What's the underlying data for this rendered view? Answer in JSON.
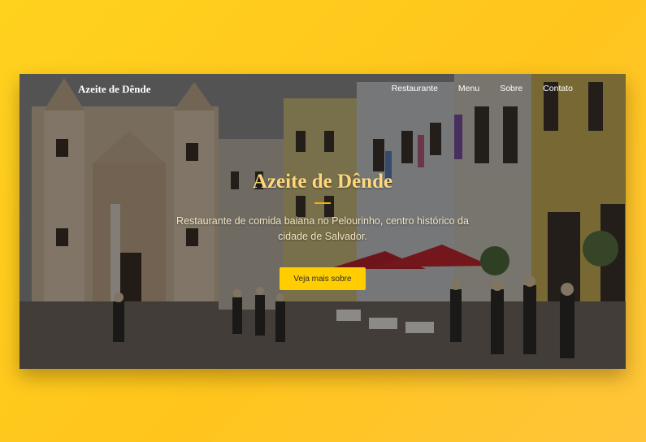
{
  "nav": {
    "brand": "Azeite de Dênde",
    "links": [
      {
        "label": "Restaurante"
      },
      {
        "label": "Menu"
      },
      {
        "label": "Sobre"
      },
      {
        "label": "Contato"
      }
    ]
  },
  "hero": {
    "title": "Azeite de Dênde",
    "subtitle": "Restaurante de comida baiana no Pelourinho, centro histórico da cidade de Salvador.",
    "button_label": "Veja mais sobre"
  },
  "colors": {
    "page_background": "#ffcd1e",
    "accent": "#ffcd00",
    "title_color": "#ffd77d"
  }
}
